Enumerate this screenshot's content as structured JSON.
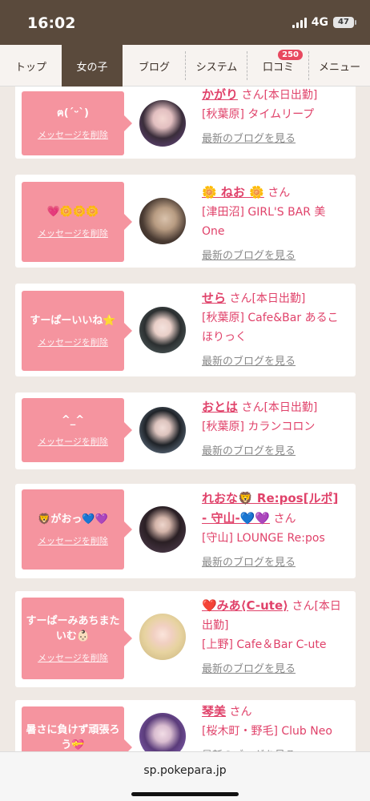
{
  "status": {
    "time": "16:02",
    "network": "4G",
    "battery": "47"
  },
  "nav": {
    "tabs": [
      {
        "label": "トップ",
        "active": false
      },
      {
        "label": "女の子",
        "active": true
      },
      {
        "label": "ブログ",
        "active": false
      },
      {
        "label": "システム",
        "active": false
      },
      {
        "label": "口コミ",
        "active": false,
        "badge": "250"
      },
      {
        "label": "メニュー",
        "active": false
      }
    ]
  },
  "delete_label": "メッセージを削除",
  "blog_label": "最新のブログを見る",
  "cards": [
    {
      "message": "ฅ(ˊᵕˋ)",
      "name": "かがり",
      "san": "さん[本日出勤]",
      "shop": "[秋葉原] タイムリープ"
    },
    {
      "message": "💗🌼🌼🌼",
      "name": "🌼 ねお 🌼",
      "san": "さん",
      "shop": "[津田沼] GIRL'S BAR 美One"
    },
    {
      "message": "すーぱーいいね⭐️",
      "name": "せら",
      "san": "さん[本日出勤]",
      "shop": "[秋葉原] Cafe&Bar あるこほりっく"
    },
    {
      "message": "^_^",
      "name": "おとは",
      "san": "さん[本日出勤]",
      "shop": "[秋葉原] カランコロン"
    },
    {
      "message": "🦁がおっ💙💜",
      "name": "れおな🦁 Re:pos[ルポ] - 守山-💙💜",
      "san": "さん",
      "shop": "[守山] LOUNGE Re:pos"
    },
    {
      "message": "すーぱーみあちまたいむ👶🏻",
      "name": "❤️みあ⟨C-ute⟩",
      "san": "さん[本日出勤]",
      "shop": "[上野] Cafe＆Bar C-ute"
    },
    {
      "message": "暑さに負けず頑張ろう💝",
      "name": "琴美",
      "san": "さん",
      "shop": "[桜木町・野毛] Club Neo"
    }
  ],
  "url": "sp.pokepara.jp",
  "colors": {
    "statusbar": "#5a4a3c",
    "bubble": "#f5949f",
    "accent": "#e0426a",
    "badge": "#e8485f"
  }
}
